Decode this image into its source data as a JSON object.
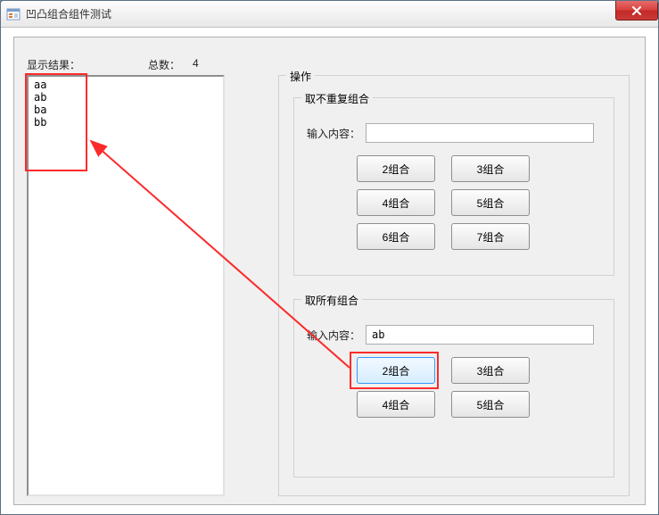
{
  "window": {
    "title": "凹凸组合组件测试"
  },
  "labels": {
    "result": "显示结果：",
    "total": "总数：",
    "total_value": "4",
    "operation": "操作",
    "group_unique": "取不重复组合",
    "group_all": "取所有组合",
    "input_content": "输入内容："
  },
  "results": [
    "aa",
    "ab",
    "ba",
    "bb"
  ],
  "unique": {
    "input_value": "",
    "buttons": [
      "2组合",
      "3组合",
      "4组合",
      "5组合",
      "6组合",
      "7组合"
    ]
  },
  "all": {
    "input_value": "ab",
    "buttons": [
      "2组合",
      "3组合",
      "4组合",
      "5组合"
    ]
  },
  "annotations": {
    "highlight_color": "#fc2b2b"
  }
}
